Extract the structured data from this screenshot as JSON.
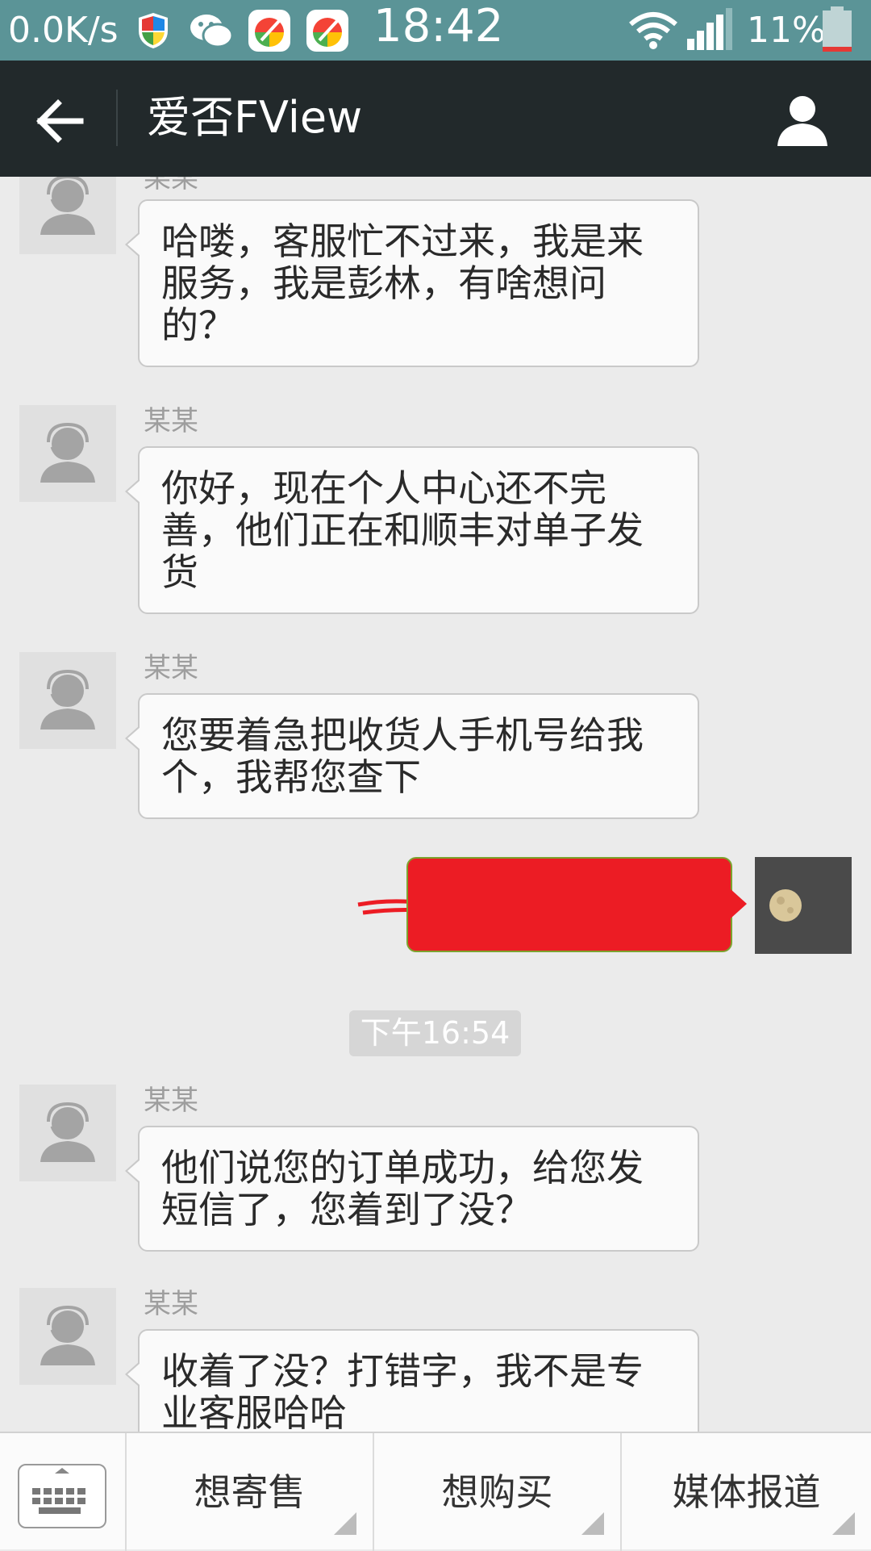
{
  "status_bar": {
    "net_speed": "0.0K/s",
    "time": "18:42",
    "battery": "11%",
    "icons": [
      "shield-icon",
      "wechat-icon",
      "app-icon",
      "app-icon",
      "wifi-icon",
      "signal-icon",
      "battery-icon"
    ]
  },
  "title_bar": {
    "title": "爱否FView",
    "back_icon": "arrow-left-icon",
    "profile_icon": "person-icon"
  },
  "messages": [
    {
      "from": "other",
      "sender": "某某",
      "text": "哈喽，客服忙不过来，我是来服务，我是彭林，有啥想问的？"
    },
    {
      "from": "other",
      "sender": "某某",
      "text": "你好，现在个人中心还不完善，他们正在和顺丰对单子发货"
    },
    {
      "from": "other",
      "sender": "某某",
      "text": "您要着急把收货人手机号给我个，我帮您查下"
    },
    {
      "from": "self",
      "text": ""
    },
    {
      "type": "time",
      "text": "下午16:54"
    },
    {
      "from": "other",
      "sender": "某某",
      "text": "他们说您的订单成功，给您发短信了，您着到了没？"
    },
    {
      "from": "other",
      "sender": "某某",
      "text": "收着了没？打错字，我不是专业客服哈哈"
    }
  ],
  "bottom_menu": {
    "keyboard_icon": "keyboard-icon",
    "items": [
      "想寄售",
      "想购买",
      "媒体报道"
    ]
  },
  "colors": {
    "status_bar": "#5b9497",
    "title_bar": "#22292b",
    "chat_bg": "#ebebeb",
    "own_bubble": "#ec1c24"
  }
}
